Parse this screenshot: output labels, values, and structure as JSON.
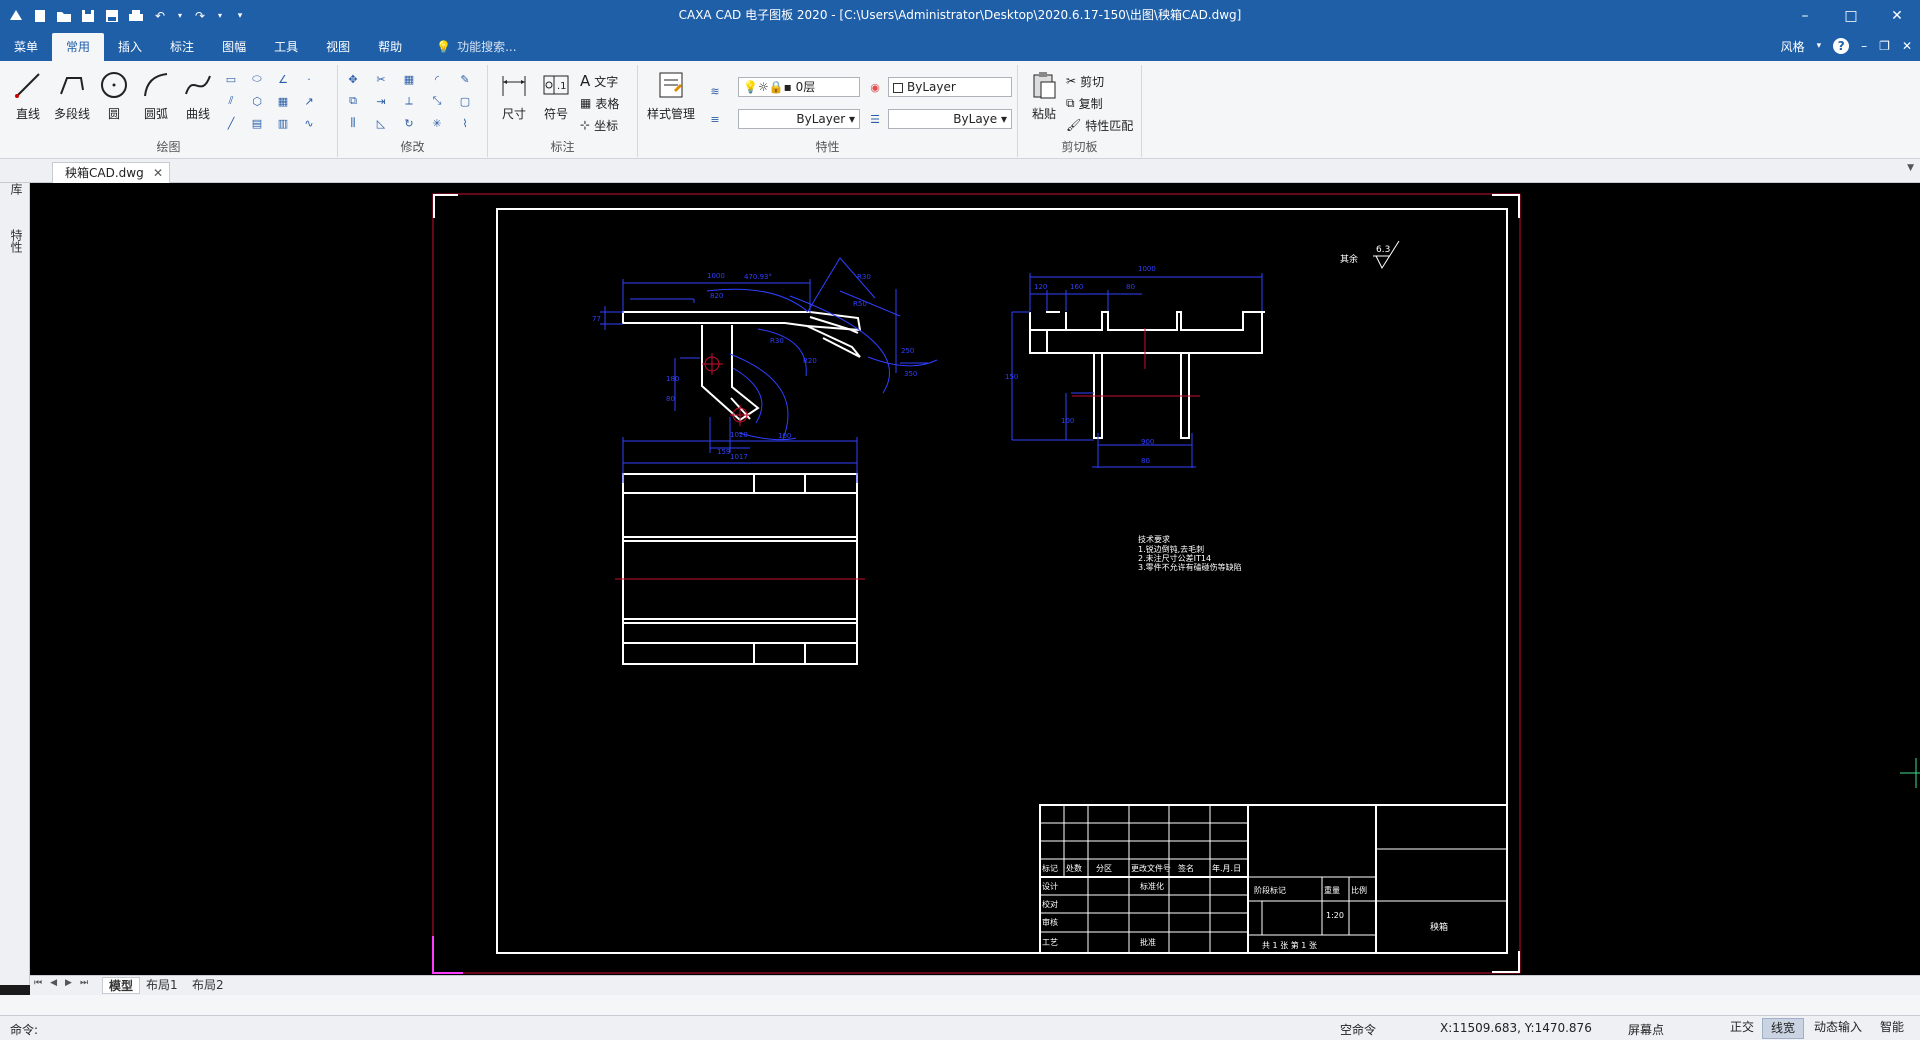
{
  "title_bar": {
    "title": "CAXA CAD 电子图板 2020 - [C:\\Users\\Administrator\\Desktop\\2020.6.17-150\\出图\\秧箱CAD.dwg]",
    "min": "–",
    "max": "□",
    "close": "✕"
  },
  "menu": {
    "tabs": [
      "菜单",
      "常用",
      "插入",
      "标注",
      "图幅",
      "工具",
      "视图",
      "帮助"
    ],
    "active": "常用",
    "search_placeholder": "功能搜索...",
    "style_label": "风格",
    "help": "?"
  },
  "ribbon": {
    "draw": {
      "label": "绘图",
      "line": "直线",
      "polyline": "多段线",
      "circle": "圆",
      "arc": "圆弧",
      "curve": "曲线"
    },
    "modify": {
      "label": "修改"
    },
    "annotate": {
      "label": "标注",
      "dimension": "尺寸",
      "symbol": "符号",
      "text": "文字",
      "table": "表格",
      "coordinate": "坐标"
    },
    "style": {
      "label": "样式管理"
    },
    "properties": {
      "label": "特性",
      "layer": "0层",
      "color": "ByLayer",
      "linetype": "ByLayer",
      "lineweight": "ByLaye"
    },
    "clipboard": {
      "label": "剪切板",
      "paste": "粘贴",
      "cut": "剪切",
      "copy": "复制",
      "match": "特性匹配"
    }
  },
  "document_tab": {
    "name": "秧箱CAD.dwg",
    "close": "✕"
  },
  "side_tabs": [
    "图库",
    "特性"
  ],
  "drawing": {
    "roughness_label": "其余",
    "roughness_value": "6.3",
    "tech_title": "技术要求",
    "tech_lines": [
      "1.锐边倒钝,去毛刺",
      "2.未注尺寸公差IT14",
      "3.零件不允许有磕碰伤等缺陷"
    ],
    "part_name": "秧箱",
    "scale": "1:20",
    "title_block": {
      "row_marks": [
        "标记",
        "处数",
        "分区",
        "更改文件号",
        "签名",
        "年.月.日"
      ],
      "design": "设计",
      "standard": "标准化",
      "check": "校对",
      "review": "审核",
      "process": "工艺",
      "approve": "批准",
      "stage_mark": "阶段标记",
      "weight": "重量",
      "ratio": "比例",
      "sheets": "共 1 张 第 1 张"
    },
    "dims_top_left": [
      "1000",
      "820",
      "470.93°",
      "R30",
      "R50",
      "R30",
      "R20",
      "250",
      "350",
      "77",
      "159",
      "100",
      "180",
      "80"
    ],
    "dims_top_right": [
      "1000",
      "120",
      "160",
      "80",
      "150",
      "100",
      "900",
      "80"
    ],
    "dims_bottom": [
      "1020",
      "1017"
    ]
  },
  "layout_tabs": [
    "模型",
    "布局1",
    "布局2"
  ],
  "command": {
    "prompt": "命令:"
  },
  "status": {
    "command_state": "空命令",
    "coords": "X:11509.683, Y:1470.876",
    "screen_point": "屏幕点",
    "ortho": "正交",
    "lineweight": "线宽",
    "dynamic_input": "动态输入",
    "smart": "智能"
  },
  "colors": {
    "accent": "#1f5fa8",
    "canvas": "#000000",
    "frame_red": "#c8102e",
    "dim_blue": "#2f3fff"
  }
}
